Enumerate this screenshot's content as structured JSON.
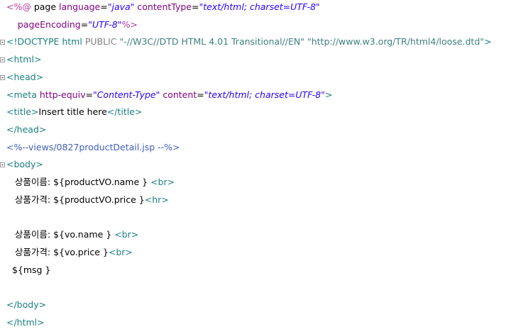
{
  "editor": {
    "lines": [
      {
        "parts": [
          [
            "d",
            "<%@ "
          ],
          [
            "txt",
            "page "
          ],
          [
            "attr",
            "language"
          ],
          [
            "txt",
            "="
          ],
          [
            "val",
            "\"java\""
          ],
          [
            "txt",
            " "
          ],
          [
            "attr",
            "contentType"
          ],
          [
            "txt",
            "="
          ],
          [
            "val",
            "\"text/html; charset=UTF-8\""
          ]
        ]
      },
      {
        "parts": [
          [
            "txt",
            "    "
          ],
          [
            "attr",
            "pageEncoding"
          ],
          [
            "txt",
            "="
          ],
          [
            "val",
            "\"UTF-8\""
          ],
          [
            "d",
            "%>"
          ]
        ]
      },
      {
        "parts": [
          [
            "tag",
            "<!DOCTYPE "
          ],
          [
            "tag",
            "html "
          ],
          [
            "doctype-pub",
            "PUBLIC "
          ],
          [
            "doctype",
            "\"-//W3C//DTD HTML 4.01 Transitional//EN\" \"http://www.w3.org/TR/html4/loose.dtd\""
          ],
          [
            "tag",
            ">"
          ]
        ]
      },
      {
        "parts": [
          [
            "tag",
            "<html>"
          ]
        ]
      },
      {
        "parts": [
          [
            "tag",
            "<head>"
          ]
        ]
      },
      {
        "parts": [
          [
            "tag",
            "<meta "
          ],
          [
            "attr",
            "http-equiv"
          ],
          [
            "txt",
            "="
          ],
          [
            "val",
            "\"Content-Type\""
          ],
          [
            "txt",
            " "
          ],
          [
            "attr",
            "content"
          ],
          [
            "txt",
            "="
          ],
          [
            "val",
            "\"text/html; charset=UTF-8\""
          ],
          [
            "tag",
            ">"
          ]
        ]
      },
      {
        "parts": [
          [
            "tag",
            "<title>"
          ],
          [
            "txt",
            "Insert title here"
          ],
          [
            "tag",
            "</title>"
          ]
        ]
      },
      {
        "parts": [
          [
            "tag",
            "</head>"
          ]
        ]
      },
      {
        "parts": [
          [
            "jspc",
            "<%--views/0827productDetail.jsp --%>"
          ]
        ]
      },
      {
        "parts": [
          [
            "tag",
            "<body>"
          ]
        ]
      },
      {
        "parts": [
          [
            "txt",
            "   상품이름: ${productVO.name } "
          ],
          [
            "tag",
            "<br>"
          ]
        ]
      },
      {
        "parts": [
          [
            "txt",
            "   상품가격: ${productVO.price }"
          ],
          [
            "tag",
            "<hr>"
          ]
        ]
      },
      {
        "parts": []
      },
      {
        "parts": [
          [
            "txt",
            "   상품이름: ${vo.name } "
          ],
          [
            "tag",
            "<br>"
          ]
        ]
      },
      {
        "parts": [
          [
            "txt",
            "   상품가격: ${vo.price }"
          ],
          [
            "tag",
            "<br>"
          ]
        ]
      },
      {
        "parts": [
          [
            "txt",
            "  ${msg }"
          ]
        ]
      },
      {
        "parts": []
      },
      {
        "parts": [
          [
            "tag",
            "</body>"
          ]
        ]
      },
      {
        "parts": [
          [
            "tag",
            "</html>"
          ]
        ]
      }
    ],
    "fold_markers": [
      {
        "line": 2,
        "symbol": "minus"
      },
      {
        "line": 3,
        "symbol": "minus"
      },
      {
        "line": 4,
        "symbol": "minus"
      },
      {
        "line": 9,
        "symbol": "minus"
      }
    ]
  }
}
